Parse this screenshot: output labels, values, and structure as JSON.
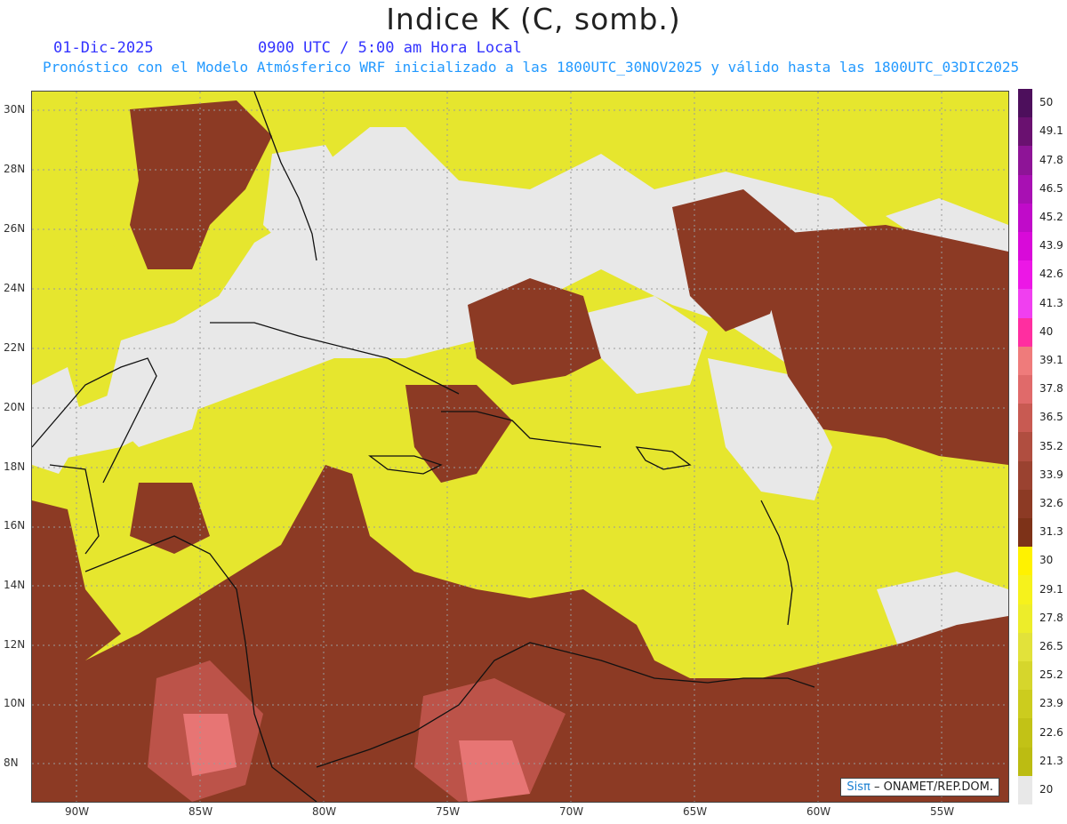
{
  "header": {
    "title": "Indice K (C, somb.)",
    "date": "01-Dic-2025",
    "time": "0900 UTC / 5:00 am Hora Local",
    "model_info": "Pronóstico con el Modelo Atmósferico WRF inicializado a las 1800UTC_30NOV2025 y válido hasta las  1800UTC_03DIC2025"
  },
  "axes": {
    "lat_labels": [
      "30N",
      "28N",
      "26N",
      "24N",
      "22N",
      "20N",
      "18N",
      "16N",
      "14N",
      "12N",
      "10N",
      "8N"
    ],
    "lon_labels": [
      "90W",
      "85W",
      "80W",
      "75W",
      "70W",
      "65W",
      "60W",
      "55W"
    ]
  },
  "legend": {
    "values": [
      "50",
      "49.1",
      "47.8",
      "46.5",
      "45.2",
      "43.9",
      "42.6",
      "41.3",
      "40",
      "39.1",
      "37.8",
      "36.5",
      "35.2",
      "33.9",
      "32.6",
      "31.3",
      "30",
      "29.1",
      "27.8",
      "26.5",
      "25.2",
      "23.9",
      "22.6",
      "21.3",
      "20"
    ],
    "colors": [
      "#4d0f5c",
      "#6a1170",
      "#8e1497",
      "#a810b3",
      "#c00bc9",
      "#d80ad9",
      "#ec17e6",
      "#f03ff0",
      "#ff2ea0",
      "#ef7b7b",
      "#e06a6a",
      "#c85a52",
      "#b04e40",
      "#9a4230",
      "#8c3a24",
      "#7d3218",
      "#fff200",
      "#f6f21c",
      "#eded2a",
      "#e2e23a",
      "#d6d62c",
      "#cccc1e",
      "#c2c216",
      "#bcbc12",
      "#e8e8e8"
    ]
  },
  "credit": {
    "brand": "Sisπ",
    "text": " – ONAMET/REP.DOM."
  }
}
